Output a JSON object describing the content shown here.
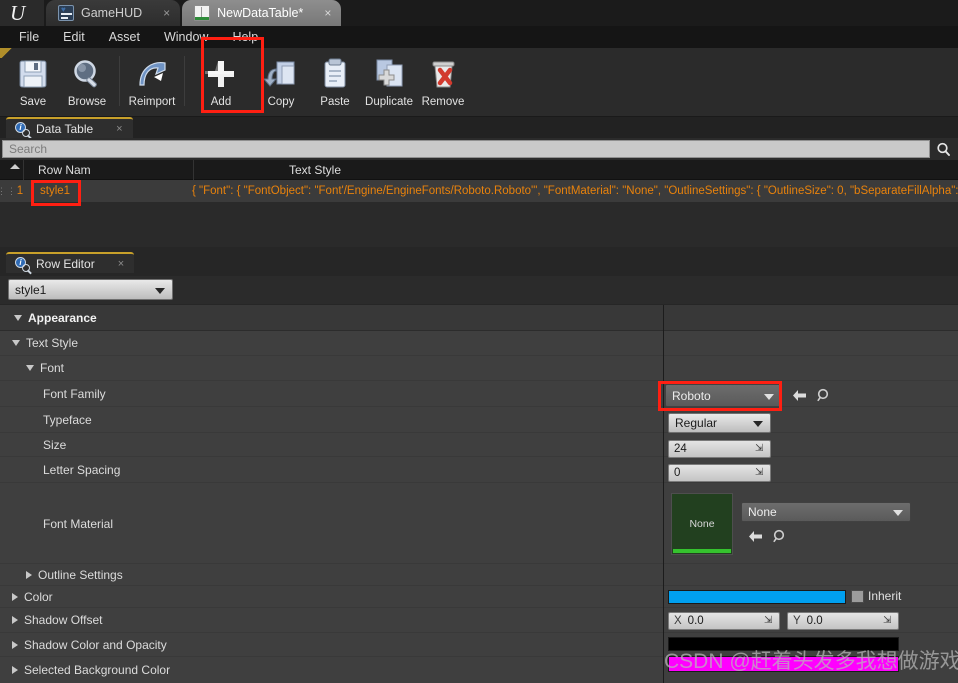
{
  "window": {
    "logo_icon": "unreal-engine-logo",
    "tabs": [
      {
        "label": "GameHUD",
        "icon": "widget-blueprint-icon",
        "close": "×",
        "active": false
      },
      {
        "label": "NewDataTable*",
        "icon": "data-table-icon",
        "close": "×",
        "active": true
      }
    ]
  },
  "menu": {
    "items": [
      "File",
      "Edit",
      "Asset",
      "Window",
      "Help"
    ]
  },
  "toolbar": {
    "buttons": [
      {
        "label": "Save",
        "icon": "floppy-disk-icon"
      },
      {
        "label": "Browse",
        "icon": "magnifier-icon"
      },
      {
        "label": "Reimport",
        "icon": "reimport-arrow-icon"
      },
      {
        "label": "Add",
        "icon": "plus-icon"
      },
      {
        "label": "Copy",
        "icon": "copy-pages-icon"
      },
      {
        "label": "Paste",
        "icon": "clipboard-icon"
      },
      {
        "label": "Duplicate",
        "icon": "duplicate-pages-icon"
      },
      {
        "label": "Remove",
        "icon": "trash-can-icon"
      }
    ]
  },
  "data_table_panel": {
    "tab_label": "Data Table",
    "tab_icon": "info-magnifier-icon",
    "tab_close": "×",
    "search": {
      "placeholder": "Search",
      "value": "",
      "icon": "search-magnifier-icon"
    },
    "columns": [
      "Row Nam",
      "Text Style"
    ],
    "rows": [
      {
        "index": "1",
        "grip": "⸺",
        "row_name": "style1",
        "text_style": "{ \"Font\": { \"FontObject\": \"Font'/Engine/EngineFonts/Roboto.Roboto'\", \"FontMaterial\": \"None\", \"OutlineSettings\": { \"OutlineSize\": 0, \"bSeparateFillAlpha\": false, \""
      }
    ]
  },
  "row_editor_panel": {
    "tab_label": "Row Editor",
    "tab_icon": "info-magnifier-icon",
    "tab_close": "×",
    "row_selector": {
      "value": "style1",
      "icon": "chevron-down-icon"
    },
    "categories": [
      {
        "label": "Appearance",
        "expanded": true
      },
      {
        "label": "Text Style",
        "expanded": true
      },
      {
        "label": "Font",
        "expanded": true
      }
    ],
    "properties": [
      {
        "label": "Font Family"
      },
      {
        "label": "Typeface"
      },
      {
        "label": "Size"
      },
      {
        "label": "Letter Spacing"
      },
      {
        "label": "Font Material"
      },
      {
        "label": "Outline Settings",
        "expanded": false
      },
      {
        "label": "Color",
        "expanded": false
      },
      {
        "label": "Shadow Offset",
        "expanded": false
      },
      {
        "label": "Shadow Color and Opacity",
        "expanded": false
      },
      {
        "label": "Selected Background Color",
        "expanded": false
      }
    ],
    "values": {
      "font_family": "Roboto",
      "typeface": "Regular",
      "size": "24",
      "letter_spacing": "0",
      "font_material_thumb": "None",
      "font_material": "None",
      "color_swatch": "#00a0f0",
      "inherit_label": "Inherit",
      "shadow_offset_x_label": "X",
      "shadow_offset_x": "0.0",
      "shadow_offset_y_label": "Y",
      "shadow_offset_y": "0.0",
      "shadow_color_swatch": "#000000",
      "selected_bg_swatch": "#ff00ff",
      "browse_icon": "browse-magnifier-icon",
      "use_selected_icon": "left-arrow-icon",
      "spinner_icon": "spinner-arrows-icon"
    }
  },
  "annotations": {
    "highlight_color": "#ff1f12",
    "boxes": [
      "add-toolbar-button",
      "style1-row-name-cell",
      "font-family-combo"
    ]
  },
  "watermark": {
    "text": "CSDN @赶着头发多我想做游戏"
  }
}
